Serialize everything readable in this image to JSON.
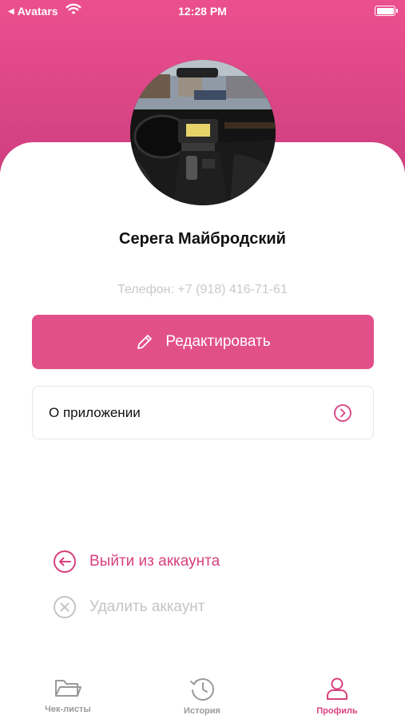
{
  "status_bar": {
    "back_label": "Avatars",
    "time": "12:28 PM"
  },
  "profile": {
    "name": "Серега Майбродский",
    "phone": "Телефон: +7 (918) 416-71-61"
  },
  "actions": {
    "edit_label": "Редактировать",
    "about_label": "О приложении",
    "logout_label": "Выйти из аккаунта",
    "delete_label": "Удалить аккаунт"
  },
  "tabs": [
    {
      "label": "Чек-листы",
      "icon": "folder-icon",
      "active": false
    },
    {
      "label": "История",
      "icon": "history-icon",
      "active": false
    },
    {
      "label": "Профиль",
      "icon": "profile-icon",
      "active": true
    }
  ],
  "colors": {
    "accent": "#e2508a",
    "header_gradient_top": "#ec4f8e",
    "header_gradient_bottom": "#cf3f80",
    "muted": "#c4c4c4"
  }
}
